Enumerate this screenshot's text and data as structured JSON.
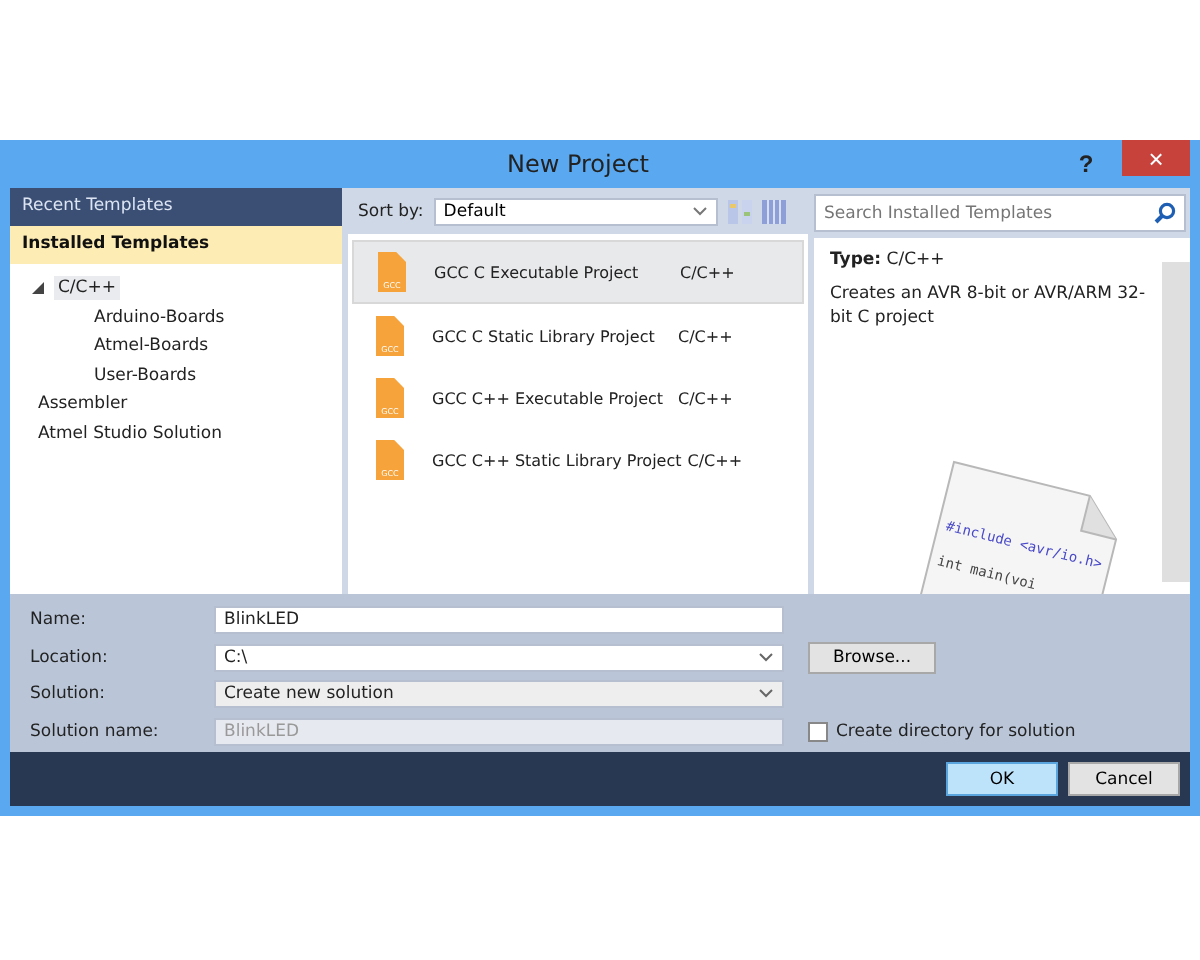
{
  "window": {
    "title": "New Project",
    "help": "?",
    "close": "×"
  },
  "sidebar": {
    "sections": [
      {
        "label": "Recent Templates",
        "selected": false
      },
      {
        "label": "Installed Templates",
        "selected": true
      }
    ],
    "tree": [
      {
        "label": "C/C++",
        "expanded": true,
        "selected": true,
        "children": [
          {
            "label": "Arduino-Boards",
            "selected": false
          },
          {
            "label": "Atmel-Boards",
            "selected": false
          },
          {
            "label": "User-Boards",
            "selected": false
          }
        ]
      },
      {
        "label": "Assembler",
        "selected": false
      },
      {
        "label": "Atmel Studio Solution",
        "selected": false
      }
    ]
  },
  "toolbar": {
    "sort_label": "Sort by:",
    "sort_value": "Default",
    "search_placeholder": "Search Installed Templates"
  },
  "templates": [
    {
      "name": "GCC C Executable Project",
      "type": "C/C++",
      "icon_text": "GCC",
      "selected": true
    },
    {
      "name": "GCC C Static Library Project",
      "type": "C/C++",
      "icon_text": "GCC",
      "selected": false
    },
    {
      "name": "GCC C++ Executable Project",
      "type": "C/C++",
      "icon_text": "GCC",
      "selected": false
    },
    {
      "name": "GCC C++ Static Library Project",
      "type": "C/C++",
      "icon_text": "GCC",
      "selected": false
    }
  ],
  "details": {
    "type_label": "Type:",
    "type_value": "C/C++",
    "description": "Creates an AVR 8-bit or AVR/ARM 32-bit C project",
    "code_lines": [
      "#include <avr/io.h>",
      "int main(voi"
    ]
  },
  "form": [
    {
      "label": "Name:",
      "value": "BlinkLED",
      "kind": "text"
    },
    {
      "label": "Location:",
      "value": "C:\\",
      "kind": "combo"
    },
    {
      "label": "Solution:",
      "value": "Create new solution",
      "kind": "select"
    },
    {
      "label": "Solution name:",
      "value": "BlinkLED",
      "kind": "text",
      "disabled": true
    }
  ],
  "browse_button": "Browse...",
  "create_directory": {
    "label": "Create directory for solution",
    "checked": false
  },
  "buttons": [
    "OK",
    "Cancel"
  ]
}
